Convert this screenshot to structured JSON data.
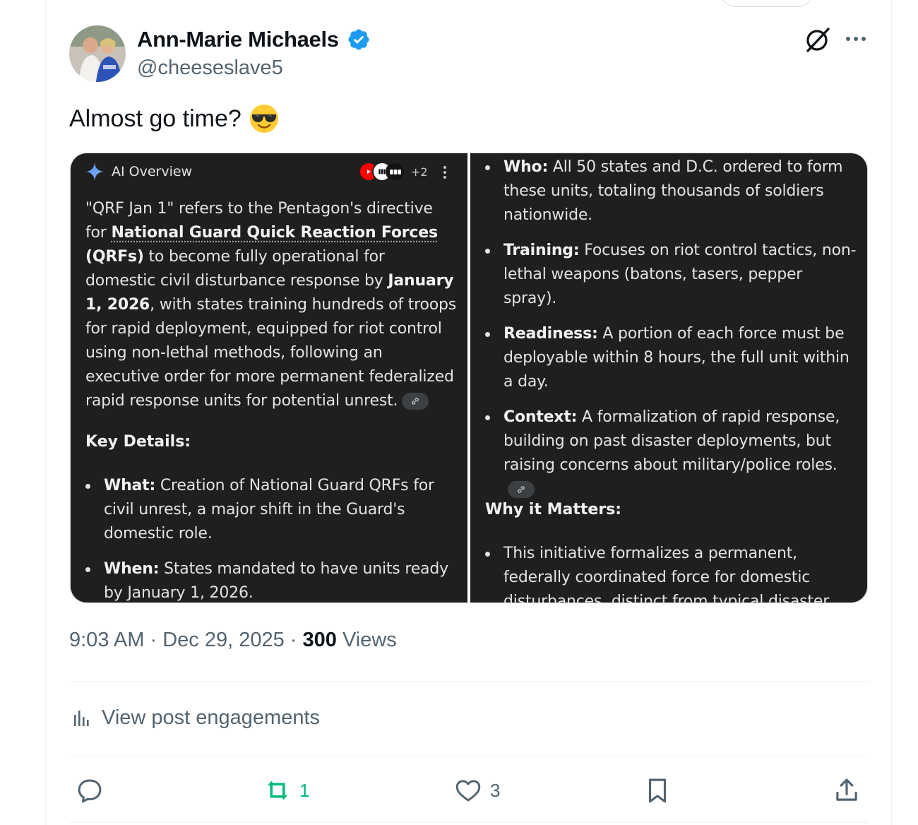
{
  "author": {
    "display_name": "Ann-Marie Michaels",
    "handle": "@cheeseslave5"
  },
  "post": {
    "text": "Almost go time?",
    "emoji": "smiling-face-with-sunglasses-emoji"
  },
  "ai_overview": {
    "label": "AI Overview",
    "source_more": "+2",
    "intro_1": "\"QRF Jan 1\" refers to the Pentagon's directive for ",
    "intro_link": "National Guard Quick Reaction Forces",
    "intro_2": " (QRFs)",
    "intro_3": " to become fully operational for domestic civil disturbance response by ",
    "intro_date": "January 1, 2026",
    "intro_4": ", with states training hundreds of troops for rapid deployment, equipped for riot control using non-lethal methods, following an executive order for more permanent federalized rapid response units for potential unrest.",
    "key_details_heading": "Key Details:",
    "key_details": [
      {
        "label": "What:",
        "text": " Creation of National Guard QRFs for civil unrest, a major shift in the Guard's domestic role."
      },
      {
        "label": "When:",
        "text": " States mandated to have units ready by January 1, 2026."
      }
    ],
    "right_items": [
      {
        "label": "Who:",
        "text": " All 50 states and D.C. ordered to form these units, totaling thousands of soldiers nationwide."
      },
      {
        "label": "Training:",
        "text": " Focuses on riot control tactics, non-lethal weapons (batons, tasers, pepper spray)."
      },
      {
        "label": "Readiness:",
        "text": " A portion of each force must be deployable within 8 hours, the full unit within a day."
      },
      {
        "label": "Context:",
        "text": " A formalization of rapid response, building on past disaster deployments, but raising concerns about military/police roles."
      }
    ],
    "why_heading": "Why it Matters:",
    "why_items": [
      "This initiative formalizes a permanent, federally coordinated force for domestic disturbances, distinct from typical disaster relief"
    ]
  },
  "meta": {
    "time": "9:03 AM",
    "date": "Dec 29, 2025",
    "views_count": "300",
    "views_label": "Views",
    "separator": "·"
  },
  "engagements_label": "View post engagements",
  "actions": {
    "replies": "",
    "reposts": "1",
    "likes": "3"
  },
  "colors": {
    "text": "#0f1419",
    "secondary": "#536471",
    "verified": "#1d9bf0",
    "repost_active": "#00ba7c",
    "ai_panel_bg": "#1f1f1f"
  }
}
